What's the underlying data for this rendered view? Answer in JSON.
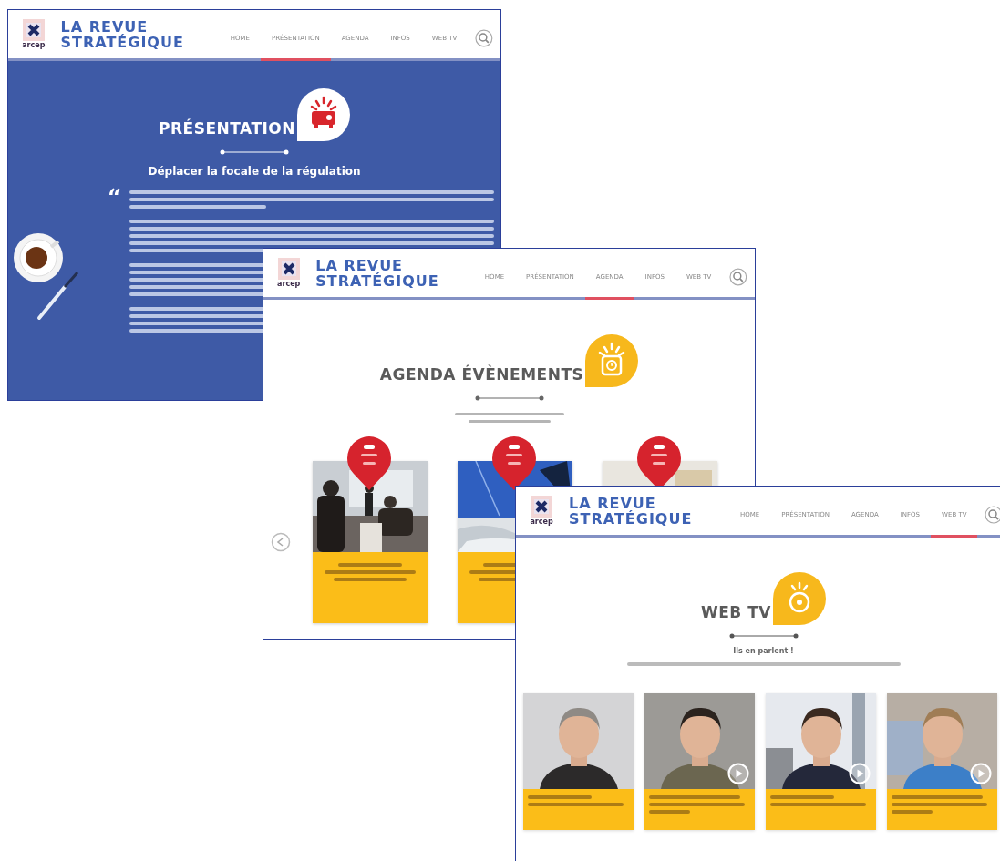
{
  "windows": [
    {
      "kind": "presentation",
      "logo_text": "arcep",
      "site_title": [
        "LA REVUE",
        "STRATÉGIQUE"
      ],
      "nav": [
        {
          "label": "HOME",
          "selected": false
        },
        {
          "label": "PRÉSENTATION",
          "selected": true
        },
        {
          "label": "AGENDA",
          "selected": false
        },
        {
          "label": "INFOS",
          "selected": false
        },
        {
          "label": "WEB TV",
          "selected": false
        }
      ],
      "section_title": "PRÉSENTATION",
      "subtitle": "Déplacer la focale de la régulation",
      "quote_mark": "“"
    },
    {
      "kind": "agenda",
      "logo_text": "arcep",
      "site_title": [
        "LA REVUE",
        "STRATÉGIQUE"
      ],
      "nav": [
        {
          "label": "HOME",
          "selected": false
        },
        {
          "label": "PRÉSENTATION",
          "selected": false
        },
        {
          "label": "AGENDA",
          "selected": true
        },
        {
          "label": "INFOS",
          "selected": false
        },
        {
          "label": "WEB TV",
          "selected": false
        }
      ],
      "section_title": "AGENDA ÉVÈNEMENTS",
      "events": [
        {
          "kind": "picture"
        },
        {
          "kind": "picture"
        },
        {
          "kind": "picture"
        }
      ]
    },
    {
      "kind": "webtv",
      "logo_text": "arcep",
      "site_title": [
        "LA REVUE",
        "STRATÉGIQUE"
      ],
      "nav": [
        {
          "label": "HOME",
          "selected": false
        },
        {
          "label": "PRÉSENTATION",
          "selected": false
        },
        {
          "label": "AGENDA",
          "selected": false
        },
        {
          "label": "INFOS",
          "selected": false
        },
        {
          "label": "WEB TV",
          "selected": true
        }
      ],
      "section_title": "WEB TV",
      "tagline": "Ils en parlent !",
      "videos": [
        {
          "play_button": false
        },
        {
          "play_button": true
        },
        {
          "play_button": true
        },
        {
          "play_button": true
        }
      ]
    }
  ]
}
